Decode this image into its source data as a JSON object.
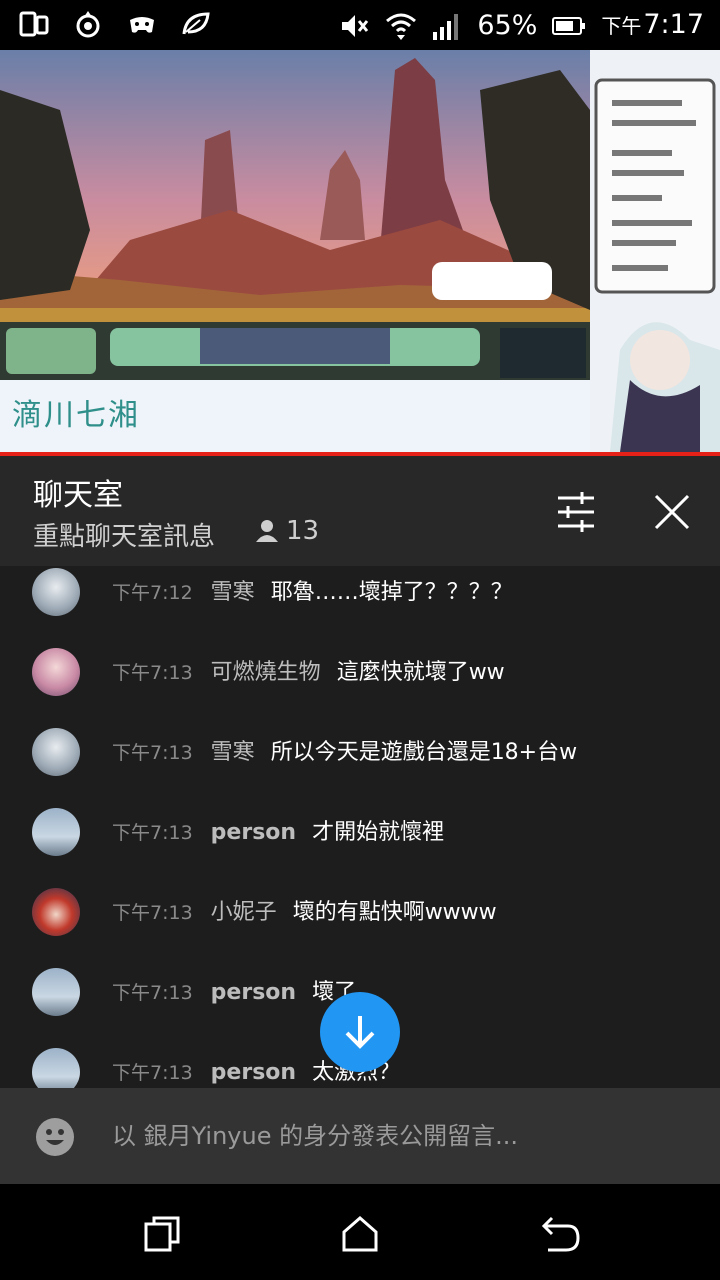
{
  "status_bar": {
    "battery": "65%",
    "time_prefix": "下午",
    "time": "7:17",
    "icons": [
      "phone-icon",
      "app-icon",
      "game-controller-icon",
      "leaf-icon",
      "mute-icon",
      "wifi-icon",
      "signal-icon",
      "battery-icon"
    ]
  },
  "video": {
    "stream_logo": "滴川七湘"
  },
  "chat": {
    "title": "聊天室",
    "mode": "重點聊天室訊息",
    "viewers": "13",
    "messages": [
      {
        "time": "下午7:12",
        "author": "雪寒",
        "text": "耶魯……壞掉了？？？？"
      },
      {
        "time": "下午7:13",
        "author": "可燃燒生物",
        "text": "這麼快就壞了ww"
      },
      {
        "time": "下午7:13",
        "author": "雪寒",
        "text": "所以今天是遊戲台還是18+台w"
      },
      {
        "time": "下午7:13",
        "author": "person",
        "text": "才開始就懷裡"
      },
      {
        "time": "下午7:13",
        "author": "小妮子",
        "text": "壞的有點快啊wwww"
      },
      {
        "time": "下午7:13",
        "author": "person",
        "text": "壞了"
      },
      {
        "time": "下午7:13",
        "author": "person",
        "text": "太激烈？"
      }
    ]
  },
  "input": {
    "placeholder": "以 銀月Yinyue 的身分發表公開留言..."
  },
  "colors": {
    "accent_red": "#e62117",
    "scroll_button": "#2196f3",
    "header_bg": "#282828",
    "chat_bg": "#1d1d1d"
  }
}
